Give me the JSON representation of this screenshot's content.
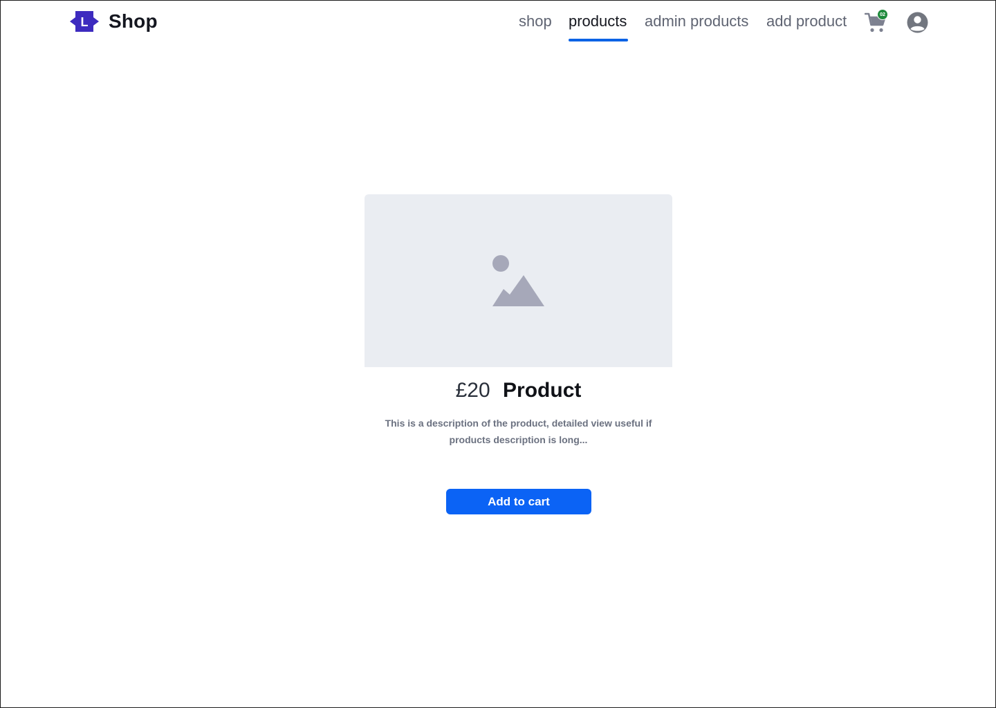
{
  "brand": {
    "logo_letter": "L",
    "logo_color": "#3d2bbf",
    "name": "Shop"
  },
  "nav": {
    "items": [
      {
        "label": "shop",
        "active": false
      },
      {
        "label": "products",
        "active": true
      },
      {
        "label": "admin products",
        "active": false
      },
      {
        "label": "add product",
        "active": false
      }
    ],
    "accent_color": "#0b63e5"
  },
  "cart": {
    "icon": "cart-icon",
    "badge_count": "02",
    "badge_color": "#1f8a3c"
  },
  "account": {
    "icon": "account-circle-icon"
  },
  "product": {
    "image_icon": "image-placeholder-icon",
    "price": "£20",
    "name": "Product",
    "description": "This is a description of the product, detailed view useful if products description is long...",
    "add_to_cart_label": "Add to cart",
    "button_color": "#0b63f5"
  }
}
